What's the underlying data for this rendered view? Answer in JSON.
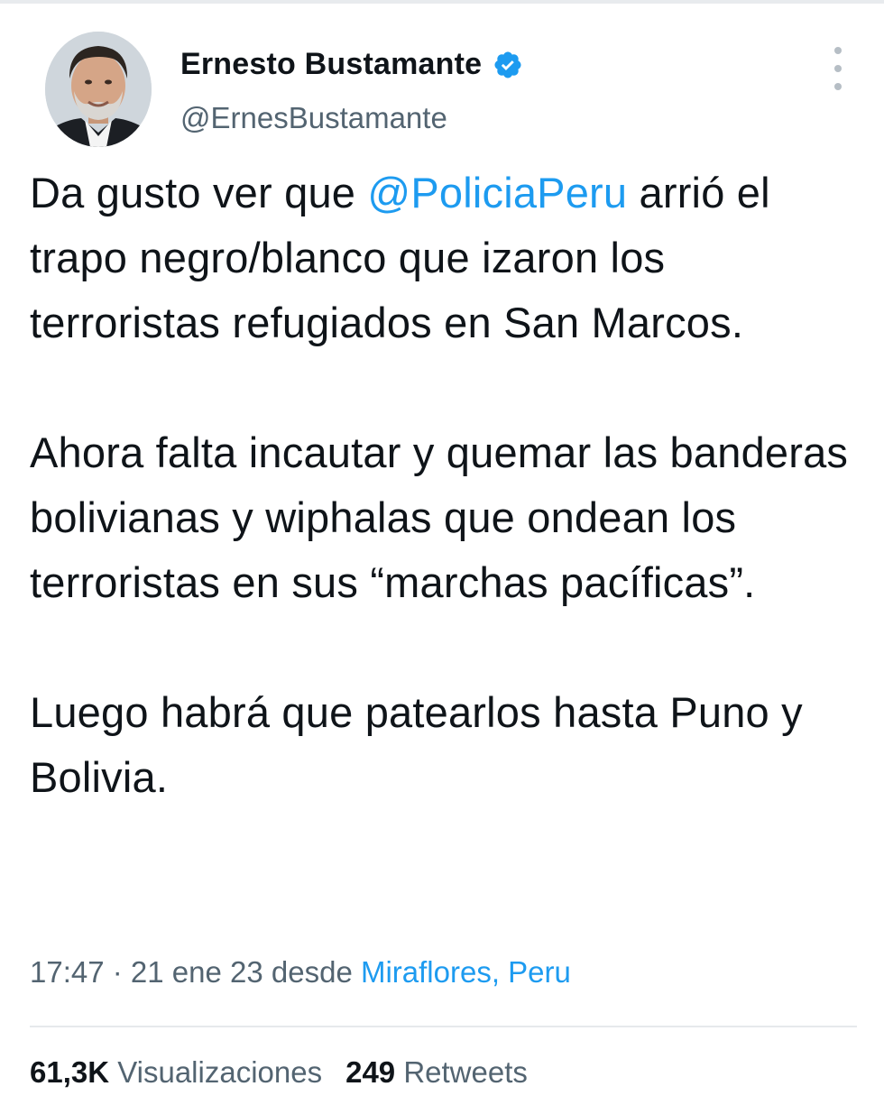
{
  "author": {
    "name": "Ernesto Bustamante",
    "handle": "@ErnesBustamante",
    "verified": true,
    "avatar_icon": "profile-photo"
  },
  "tweet": {
    "line1_before": "Da gusto ver que ",
    "mention": "@PoliciaPeru",
    "line1_after": " arrió el trapo negro/blanco que izaron los terroristas refugiados en San Marcos.",
    "paragraph2": "Ahora falta incautar y quemar las banderas bolivianas y wiphalas que ondean los terroristas en sus “marchas pacíficas”.",
    "paragraph3": "Luego habrá que patearlos hasta Puno y Bolivia."
  },
  "meta": {
    "timestamp": "17:47 · 21 ene 23 desde ",
    "location": "Miraflores, Peru"
  },
  "stats": {
    "views_count": "61,3K",
    "views_label": "Visualizaciones",
    "retweets_count": "249",
    "retweets_label": "Retweets"
  },
  "colors": {
    "accent": "#1d9bf0",
    "text": "#0f1419",
    "secondary": "#536471"
  }
}
